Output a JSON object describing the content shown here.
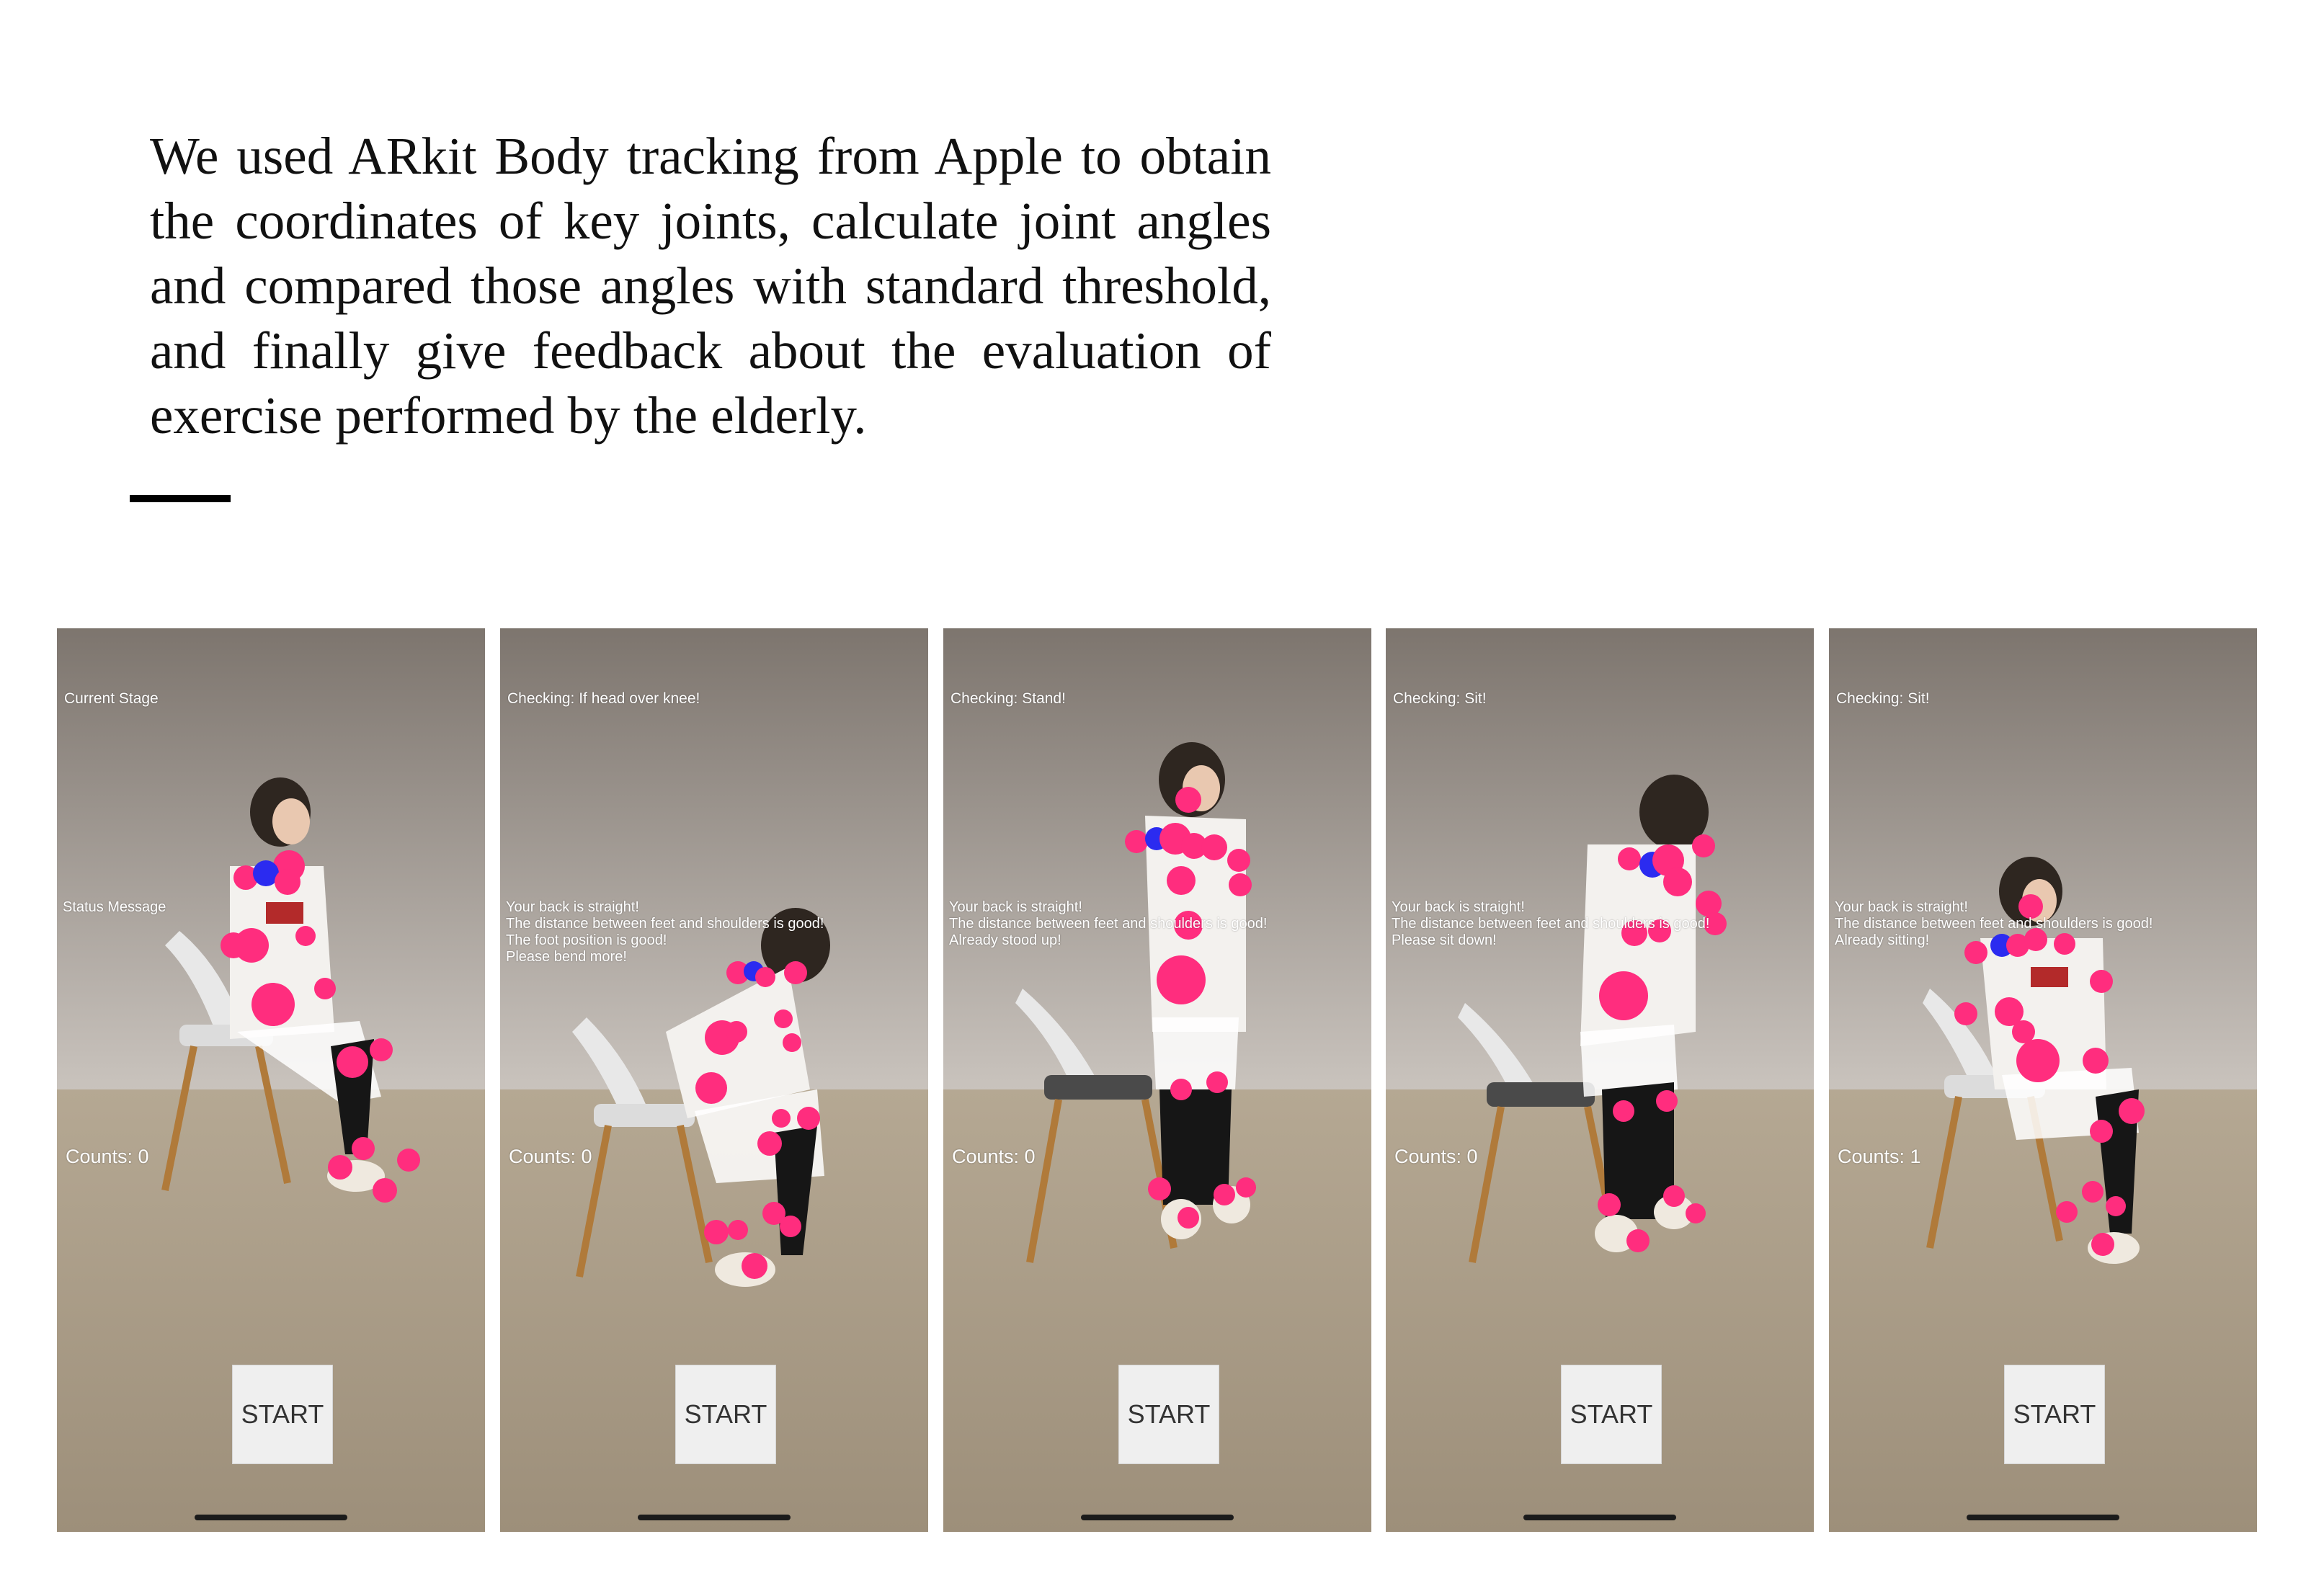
{
  "intro_text": "We used ARkit Body tracking from Apple to obtain the coordinates of key joints, calculate joint angles and compared those angles with standard threshold, and finally give feedback about the evaluation of exercise performed by the elderly.",
  "colors": {
    "joint": "#ff2d7e",
    "joint_hip": "#2b2bf0",
    "wall": "#8a837c",
    "floor": "#a89a85"
  },
  "screens": [
    {
      "stage": "Current Stage",
      "status": [
        "Status Message"
      ],
      "counts": "Counts: 0",
      "button": "START",
      "pose": "sitting"
    },
    {
      "stage": "Checking: If head over knee!",
      "status": [
        "Your back is straight!",
        "The distance between feet and shoulders is good!",
        "The foot position is good!",
        "Please bend more!"
      ],
      "counts": "Counts: 0",
      "button": "START",
      "pose": "bending"
    },
    {
      "stage": "Checking: Stand!",
      "status": [
        "Your back is straight!",
        "The distance between feet and shoulders is good!",
        "Already stood up!"
      ],
      "counts": "Counts: 0",
      "button": "START",
      "pose": "standing"
    },
    {
      "stage": "Checking: Sit!",
      "status": [
        "Your back is straight!",
        "The distance between feet and shoulders is good!",
        "Please sit down!"
      ],
      "counts": "Counts: 0",
      "button": "START",
      "pose": "lowering"
    },
    {
      "stage": "Checking: Sit!",
      "status": [
        "Your back is straight!",
        "The distance between feet and shoulders is good!",
        "Already sitting!"
      ],
      "counts": "Counts: 1",
      "button": "START",
      "pose": "sitting"
    }
  ]
}
